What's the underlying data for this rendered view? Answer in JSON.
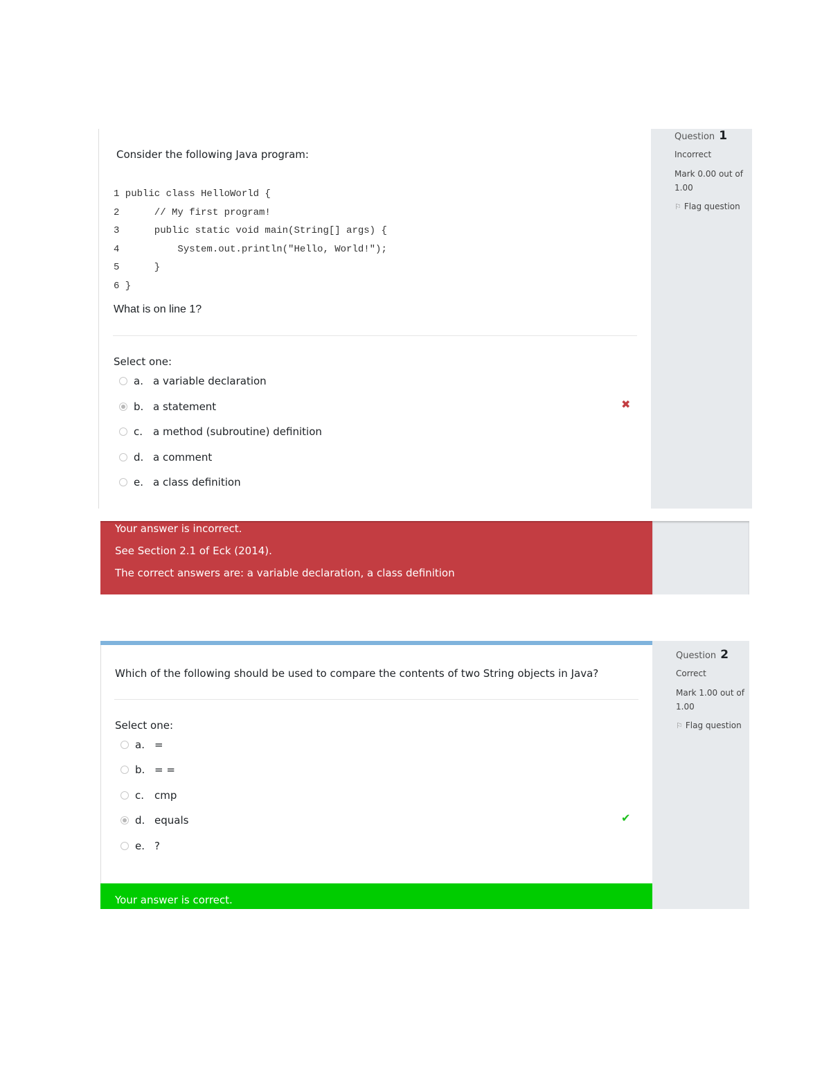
{
  "questions": [
    {
      "info": {
        "label": "Question",
        "number": "1",
        "state": "Incorrect",
        "mark_line1": "Mark 0.00 out of",
        "mark_line2": "1.00",
        "flag_label": "Flag question",
        "flag_icon": "flag-icon"
      },
      "intro": "Consider the following Java program:",
      "code_lines": [
        "1 public class HelloWorld {",
        "2      // My first program!",
        "3      public static void main(String[] args) {",
        "4          System.out.println(\"Hello, World!\");",
        "5      }",
        "6 }"
      ],
      "prompt": "What is on line 1?",
      "select_label": "Select one:",
      "options": [
        {
          "letter": "a.",
          "text": "a variable declaration",
          "selected": false
        },
        {
          "letter": "b.",
          "text": "a statement",
          "selected": true,
          "result_icon": "incorrect-x-icon"
        },
        {
          "letter": "c.",
          "text": "a method (subroutine) definition",
          "selected": false
        },
        {
          "letter": "d.",
          "text": "a comment",
          "selected": false
        },
        {
          "letter": "e.",
          "text": "a class definition",
          "selected": false
        }
      ],
      "result_glyph": "✖",
      "feedback": {
        "color": "#c33d42",
        "lines": [
          "Your answer is incorrect.",
          "See Section 2.1 of Eck (2014).",
          "The correct answers are: a variable declaration, a class definition"
        ]
      }
    },
    {
      "info": {
        "label": "Question",
        "number": "2",
        "state": "Correct",
        "mark_line1": "Mark 1.00 out of",
        "mark_line2": "1.00",
        "flag_label": "Flag question",
        "flag_icon": "flag-icon"
      },
      "prompt": "Which of the following should be used to compare the contents of two String objects in Java?",
      "select_label": "Select one:",
      "options": [
        {
          "letter": "a.",
          "text": "=",
          "selected": false
        },
        {
          "letter": "b.",
          "text": "= =",
          "selected": false
        },
        {
          "letter": "c.",
          "text": "cmp",
          "selected": false
        },
        {
          "letter": "d.",
          "text": "equals",
          "selected": true,
          "result_icon": "correct-check-icon"
        },
        {
          "letter": "e.",
          "text": "?",
          "selected": false
        }
      ],
      "result_glyph": "✔",
      "feedback": {
        "color": "#00cc00",
        "lines": [
          "Your answer is correct."
        ]
      },
      "topbar_color": "#7fb3dc"
    }
  ],
  "flag_glyph": "⚐",
  "colors": {
    "info_panel": "#e7eaed",
    "incorrect": "#c33d42",
    "correct": "#00cc00"
  }
}
